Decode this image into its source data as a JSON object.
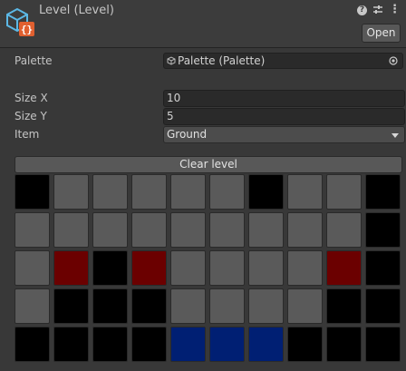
{
  "header": {
    "title": "Level (Level)",
    "open_label": "Open",
    "icons": {
      "asset": "scriptable-object-icon",
      "help": "help-icon",
      "presets": "presets-icon",
      "menu": "kebab-menu-icon"
    }
  },
  "fields": {
    "palette": {
      "label": "Palette",
      "value": "Palette (Palette)",
      "icon": "scriptable-object-icon"
    },
    "size_x": {
      "label": "Size X",
      "value": "10"
    },
    "size_y": {
      "label": "Size Y",
      "value": "5"
    },
    "item": {
      "label": "Item",
      "value": "Ground"
    }
  },
  "clear_label": "Clear level",
  "colors": {
    "ground": "#5a5a5a",
    "black": "#000000",
    "red": "#6b0000",
    "blue": "#001f73"
  },
  "grid": {
    "columns": 10,
    "rows": 5,
    "cells": [
      [
        "black",
        "ground",
        "ground",
        "ground",
        "ground",
        "ground",
        "black",
        "ground",
        "ground",
        "black"
      ],
      [
        "ground",
        "ground",
        "ground",
        "ground",
        "ground",
        "ground",
        "ground",
        "ground",
        "ground",
        "black"
      ],
      [
        "ground",
        "red",
        "black",
        "red",
        "ground",
        "ground",
        "ground",
        "ground",
        "red",
        "black"
      ],
      [
        "ground",
        "black",
        "black",
        "black",
        "ground",
        "ground",
        "ground",
        "ground",
        "black",
        "black"
      ],
      [
        "black",
        "black",
        "black",
        "black",
        "blue",
        "blue",
        "blue",
        "black",
        "black",
        "black"
      ]
    ]
  }
}
